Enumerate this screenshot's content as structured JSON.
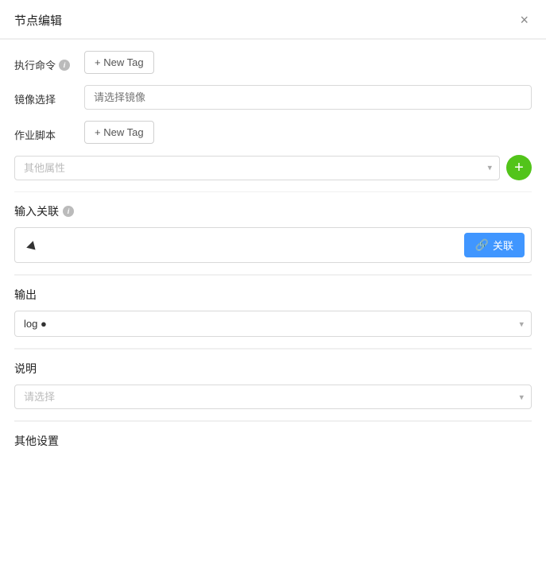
{
  "modal": {
    "title": "节点编辑",
    "close_label": "×"
  },
  "fields": {
    "execute_command": {
      "label": "执行命令",
      "has_info": true,
      "new_tag_label": "+ New Tag"
    },
    "image_select": {
      "label": "镜像选择",
      "placeholder": "请选择镜像"
    },
    "work_script": {
      "label": "作业脚本",
      "has_info": false,
      "new_tag_label": "+ New Tag"
    },
    "other_props": {
      "placeholder": "其他属性",
      "plus_title": "+"
    }
  },
  "input_link": {
    "section_title": "输入关联",
    "has_info": true,
    "link_btn_label": "关联",
    "link_icon": "🔗"
  },
  "output": {
    "section_title": "输出",
    "selected_value": "log",
    "options": [
      "log"
    ]
  },
  "description": {
    "section_title": "说明",
    "placeholder": "请选择"
  },
  "other_settings": {
    "section_title": "其他设置"
  }
}
